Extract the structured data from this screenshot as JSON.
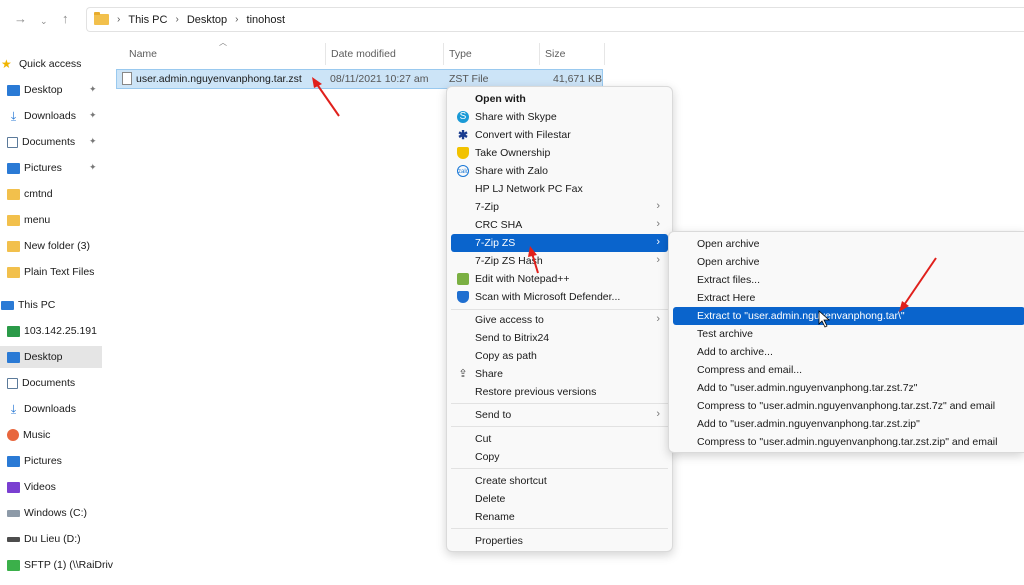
{
  "address_bar": {
    "back_icon": "arrow-right-icon",
    "breadcrumbs": [
      "This PC",
      "Desktop",
      "tinohost"
    ]
  },
  "sidebar": {
    "items": [
      {
        "label": "Quick access",
        "icon": "star-icon",
        "pinned": false
      },
      {
        "label": "Desktop",
        "icon": "desktop-folder-icon",
        "pinned": true
      },
      {
        "label": "Downloads",
        "icon": "download-icon",
        "pinned": true
      },
      {
        "label": "Documents",
        "icon": "documents-icon",
        "pinned": true
      },
      {
        "label": "Pictures",
        "icon": "pictures-icon",
        "pinned": true
      },
      {
        "label": "cmtnd",
        "icon": "folder-icon",
        "pinned": false
      },
      {
        "label": "menu",
        "icon": "folder-icon",
        "pinned": false
      },
      {
        "label": "New folder (3)",
        "icon": "folder-icon",
        "pinned": false
      },
      {
        "label": "Plain Text Files",
        "icon": "folder-icon",
        "pinned": false
      },
      {
        "label": "This PC",
        "icon": "computer-icon",
        "pinned": false
      },
      {
        "label": "103.142.25.191",
        "icon": "network-drive-icon",
        "pinned": false
      },
      {
        "label": "Desktop",
        "icon": "desktop-folder-icon",
        "pinned": false,
        "selected": true
      },
      {
        "label": "Documents",
        "icon": "documents-icon",
        "pinned": false
      },
      {
        "label": "Downloads",
        "icon": "download-icon",
        "pinned": false
      },
      {
        "label": "Music",
        "icon": "music-icon",
        "pinned": false
      },
      {
        "label": "Pictures",
        "icon": "pictures-icon",
        "pinned": false
      },
      {
        "label": "Videos",
        "icon": "videos-icon",
        "pinned": false
      },
      {
        "label": "Windows (C:)",
        "icon": "windows-drive-icon",
        "pinned": false
      },
      {
        "label": "Du Lieu (D:)",
        "icon": "drive-icon",
        "pinned": false
      },
      {
        "label": "SFTP (1) (\\\\RaiDriv",
        "icon": "sftp-drive-icon",
        "pinned": false
      }
    ]
  },
  "file_list": {
    "columns": [
      "Name",
      "Date modified",
      "Type",
      "Size"
    ],
    "rows": [
      {
        "name": "user.admin.nguyenvanphong.tar.zst",
        "date": "08/11/2021 10:27 am",
        "type": "ZST File",
        "size": "41,671 KB"
      }
    ]
  },
  "context_menu": {
    "items": [
      {
        "label": "Open with",
        "bold": true
      },
      {
        "label": "Share with Skype",
        "icon": "skype-icon"
      },
      {
        "label": "Convert with Filestar",
        "icon": "filestar-icon"
      },
      {
        "label": "Take Ownership",
        "icon": "shield-icon"
      },
      {
        "label": "Share with Zalo",
        "icon": "zalo-icon"
      },
      {
        "label": "HP LJ Network PC Fax"
      },
      {
        "label": "7-Zip",
        "submenu": true
      },
      {
        "label": "CRC SHA",
        "submenu": true
      },
      {
        "label": "7-Zip ZS",
        "submenu": true,
        "highlighted": true
      },
      {
        "label": "7-Zip ZS Hash",
        "submenu": true
      },
      {
        "label": "Edit with Notepad++",
        "icon": "notepad-icon"
      },
      {
        "label": "Scan with Microsoft Defender...",
        "icon": "defender-icon"
      },
      {
        "label": "Give access to",
        "submenu": true
      },
      {
        "label": "Send to Bitrix24"
      },
      {
        "label": "Copy as path"
      },
      {
        "label": "Share",
        "icon": "share-icon"
      },
      {
        "label": "Restore previous versions"
      },
      {
        "label": "Send to",
        "submenu": true
      },
      {
        "label": "Cut"
      },
      {
        "label": "Copy"
      },
      {
        "label": "Create shortcut"
      },
      {
        "label": "Delete"
      },
      {
        "label": "Rename"
      },
      {
        "label": "Properties"
      }
    ]
  },
  "submenu": {
    "items": [
      {
        "label": "Open archive"
      },
      {
        "label": "Open archive"
      },
      {
        "label": "Extract files..."
      },
      {
        "label": "Extract Here"
      },
      {
        "label": "Extract to \"user.admin.nguyenvanphong.tar\\\"",
        "highlighted": true
      },
      {
        "label": "Test archive"
      },
      {
        "label": "Add to archive..."
      },
      {
        "label": "Compress and email..."
      },
      {
        "label": "Add to \"user.admin.nguyenvanphong.tar.zst.7z\""
      },
      {
        "label": "Compress to \"user.admin.nguyenvanphong.tar.zst.7z\" and email"
      },
      {
        "label": "Add to \"user.admin.nguyenvanphong.tar.zst.zip\""
      },
      {
        "label": "Compress to \"user.admin.nguyenvanphong.tar.zst.zip\" and email"
      }
    ]
  },
  "colors": {
    "highlight": "#0a64cc",
    "selection": "#cce4f7",
    "annotation_arrow": "#e0201c"
  }
}
